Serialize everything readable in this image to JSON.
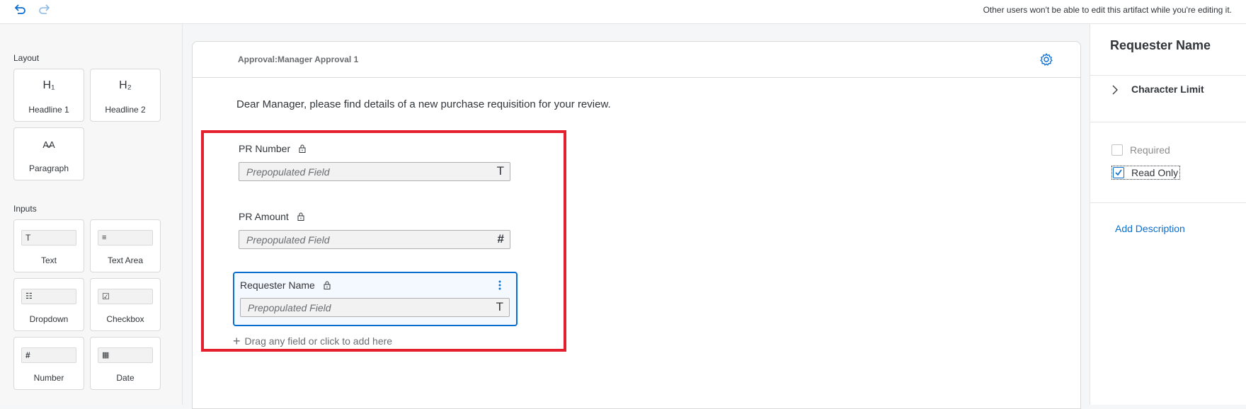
{
  "topbar": {
    "undo_icon": "undo-icon",
    "redo_icon": "redo-icon",
    "notice": "Other users won't be able to edit this artifact while you're editing it."
  },
  "palette": {
    "layout_title": "Layout",
    "layout_items": [
      {
        "label": "Headline 1",
        "glyph": "H₁"
      },
      {
        "label": "Headline 2",
        "glyph": "H₂"
      },
      {
        "label": "Paragraph",
        "glyph": "A̶A"
      }
    ],
    "inputs_title": "Inputs",
    "input_items": [
      {
        "label": "Text",
        "glyph": "T"
      },
      {
        "label": "Text Area",
        "glyph": "≡"
      },
      {
        "label": "Dropdown",
        "glyph": "☷"
      },
      {
        "label": "Checkbox",
        "glyph": "☑"
      },
      {
        "label": "Number",
        "glyph": "#"
      },
      {
        "label": "Date",
        "glyph": "▦"
      }
    ]
  },
  "canvas": {
    "form_title": "Approval:Manager Approval 1",
    "intro": "Dear Manager, please find details of a new purchase requisition for your review.",
    "fields": [
      {
        "label": "PR Number",
        "placeholder": "Prepopulated Field",
        "suffix": "T"
      },
      {
        "label": "PR Amount",
        "placeholder": "Prepopulated Field",
        "suffix": "#"
      },
      {
        "label": "Requester Name",
        "placeholder": "Prepopulated Field",
        "suffix": "T"
      }
    ],
    "drag_hint": "Drag any field or click to add here"
  },
  "properties": {
    "title": "Requester Name",
    "character_limit": "Character Limit",
    "required_label": "Required",
    "required_checked": false,
    "read_only_label": "Read Only",
    "read_only_checked": true,
    "add_description": "Add Description"
  },
  "colors": {
    "accent": "#0a6ed1",
    "highlight": "#e5202e"
  }
}
